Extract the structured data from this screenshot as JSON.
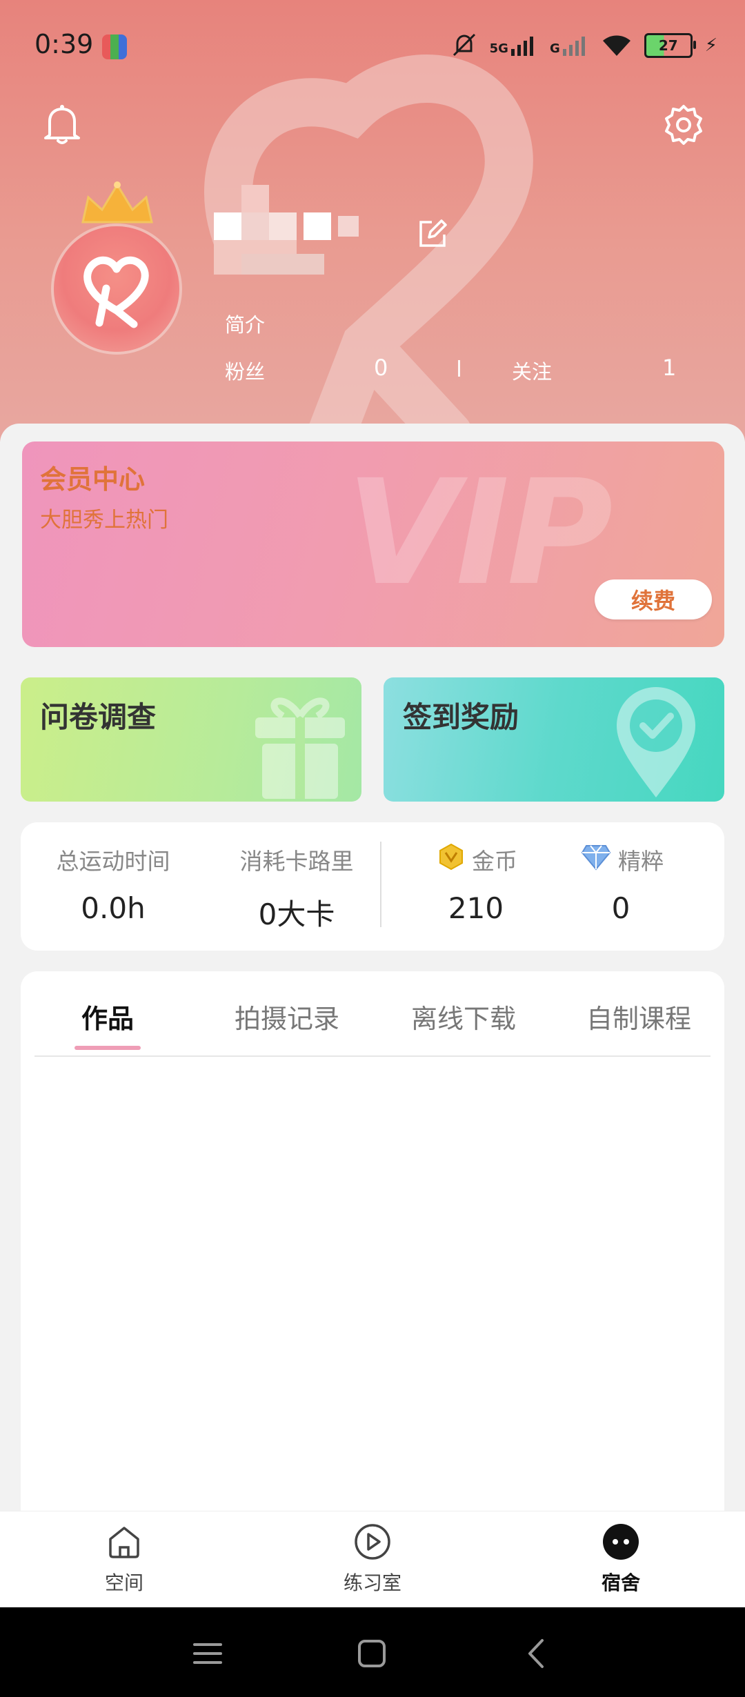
{
  "status_bar": {
    "time": "0:39",
    "network_1": "5G",
    "network_2": "G",
    "battery": "27"
  },
  "profile": {
    "bio_label": "简介",
    "fans_label": "粉丝",
    "fans_count": "0",
    "following_label": "关注",
    "following_count": "1"
  },
  "vip": {
    "title": "会员中心",
    "subtitle": "大胆秀上热门",
    "watermark": "VIP",
    "renew_label": "续费"
  },
  "cards": {
    "survey_label": "问卷调查",
    "checkin_label": "签到奖励"
  },
  "stats": {
    "total_time_label": "总运动时间",
    "total_time_value": "0.0h",
    "calories_label": "消耗卡路里",
    "calories_value": "0大卡",
    "coins_label": "金币",
    "coins_value": "210",
    "essence_label": "精粹",
    "essence_value": "0"
  },
  "tabs": [
    {
      "label": "作品",
      "active": true
    },
    {
      "label": "拍摄记录",
      "active": false
    },
    {
      "label": "离线下载",
      "active": false
    },
    {
      "label": "自制课程",
      "active": false
    }
  ],
  "bottom_nav": [
    {
      "label": "空间",
      "icon": "home-icon"
    },
    {
      "label": "练习室",
      "icon": "play-icon"
    },
    {
      "label": "宿舍",
      "icon": "dorm-icon",
      "active": true
    }
  ],
  "colors": {
    "header": "#e7837c",
    "vip_text": "#e0733a",
    "tab_underline": "#ef9db6"
  }
}
